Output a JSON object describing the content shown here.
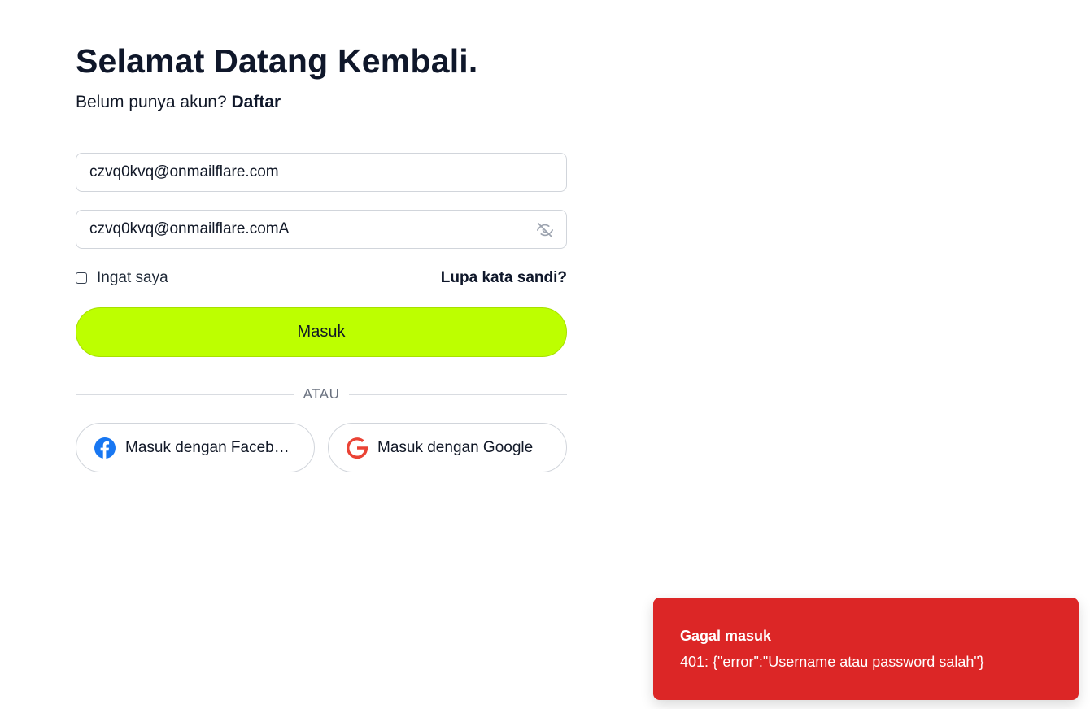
{
  "header": {
    "title": "Selamat Datang Kembali.",
    "subtitle_prefix": "Belum punya akun?",
    "register_link": "Daftar"
  },
  "form": {
    "email_value": "czvq0kvq@onmailflare.com",
    "password_value": "czvq0kvq@onmailflare.comA",
    "remember_label": "Ingat saya",
    "forgot_label": "Lupa kata sandi?",
    "submit_label": "Masuk",
    "divider_label": "ATAU"
  },
  "social": {
    "facebook_label": "Masuk dengan Facebook",
    "google_label": "Masuk dengan Google",
    "facebook_icon": "facebook-icon",
    "google_icon": "google-icon"
  },
  "toast": {
    "title": "Gagal masuk",
    "message": "401: {\"error\":\"Username atau password salah\"}"
  },
  "colors": {
    "accent": "#bdff00",
    "error": "#dc2626",
    "text": "#111827",
    "facebook": "#1877f2",
    "google": "#ea4335"
  }
}
